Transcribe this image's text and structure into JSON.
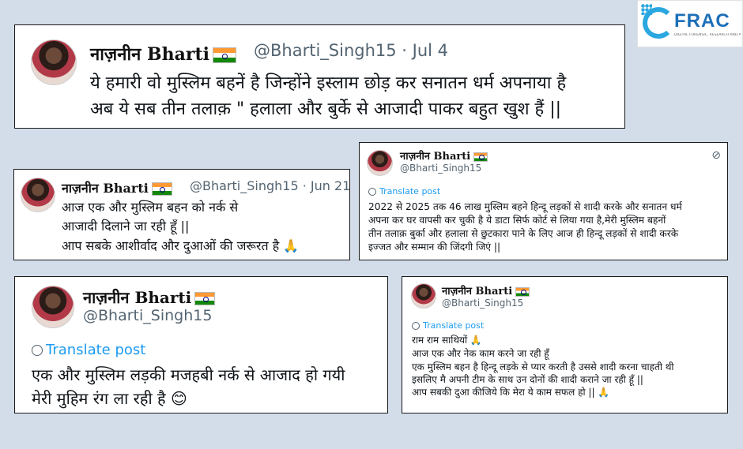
{
  "logo": {
    "word": "FRAC",
    "tagline": "DIGITAL FORENSIC, RESEARCH AND ANALYTICS CENTRE"
  },
  "posts": [
    {
      "name": "नाज़नीन Bharti",
      "handle": "@Bharti_Singh15 · Jul 4",
      "lines": [
        "ये हमारी वो मुस्लिम बहनें है जिन्होंने इस्लाम छोड़ कर सनातन धर्म अपनाया है",
        "अब ये सब तीन तलाक़ \" हलाला और बुर्के से आजादी पाकर बहुत खुश हैं ||"
      ]
    },
    {
      "name": "नाज़नीन Bharti",
      "handle": "@Bharti_Singh15 · Jun 21",
      "lines": [
        "आज एक और मुस्लिम बहन को नर्क से",
        "आजादी दिलाने जा रही हूँ ||",
        "आप सबके आशीर्वाद और दुआओं की जरूरत है 🙏"
      ]
    },
    {
      "name": "नाज़नीन Bharti",
      "handle": "@Bharti_Singh15",
      "translate": "Translate post",
      "lines": [
        "2022 से 2025 तक 46 लाख मुस्लिम बहने हिन्दू लड़कों से शादी करके और सनातन धर्म",
        "अपना कर घर वापसी कर चुकी है ये डाटा सिर्फ कोर्ट से लिया गया है,मेरी मुस्लिम बहनों",
        "तीन तलाक़ बुर्का और हलाला से छुटकारा पाने के लिए आज ही हिन्दू लड़कों से शादी करके",
        "इज्जत और सम्मान की जिंदगी जिएं ||"
      ]
    },
    {
      "name": "नाज़नीन Bharti",
      "handle": "@Bharti_Singh15",
      "translate": "Translate post",
      "lines": [
        "एक और मुस्लिम लड़की मजहबी नर्क से आजाद हो गयी",
        "मेरी मुहिम रंग ला रही है 😊"
      ]
    },
    {
      "name": "नाज़नीन Bharti",
      "handle": "@Bharti_Singh15",
      "translate": "Translate post",
      "lines": [
        "राम राम साथियों 🙏",
        "आज एक और नेक काम करने जा रही हूँ",
        "एक मुस्लिम बहन है हिन्दू लड़के से प्यार करती है उससे शादी करना चाहती थी",
        "इसलिए मै अपनी टीम के साथ उन दोनों की शादी कराने जा रही हूँ ||",
        "आप सबकी दुआ कीजिये कि मेरा ये काम सफल हो || 🙏"
      ]
    }
  ]
}
